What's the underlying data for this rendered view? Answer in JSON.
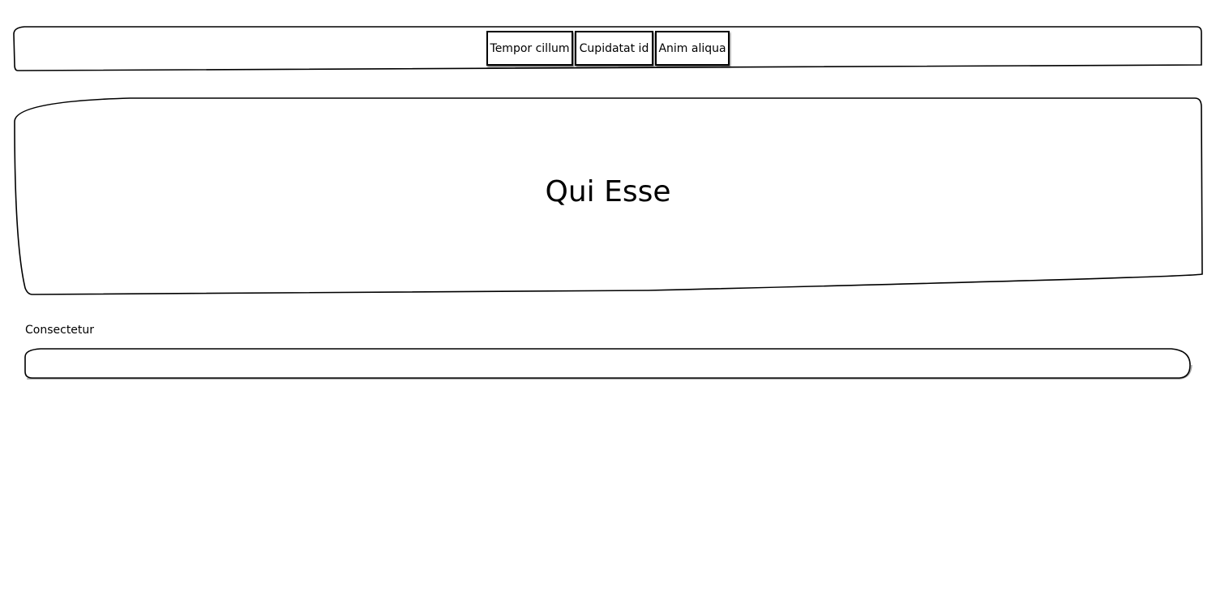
{
  "nav": {
    "items": [
      {
        "label": "Tempor cillum"
      },
      {
        "label": "Cupidatat id"
      },
      {
        "label": "Anim aliqua"
      }
    ]
  },
  "hero": {
    "title": "Qui Esse"
  },
  "form": {
    "field_label": "Consectetur",
    "field_value": "",
    "field_placeholder": ""
  }
}
